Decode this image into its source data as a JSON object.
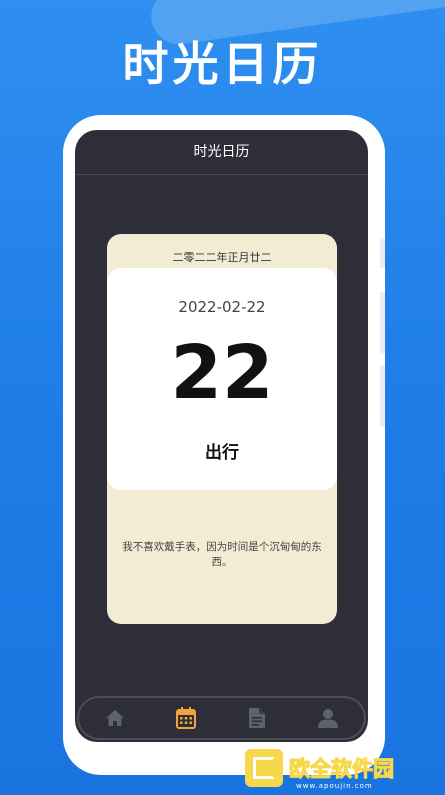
{
  "hero": {
    "title": "时光日历"
  },
  "app": {
    "title": "时光日历"
  },
  "card": {
    "lunar_date": "二零二二年正月廿二",
    "date": "2022-02-22",
    "day": "22",
    "suitable": "出行",
    "quote": "我不喜欢戴手表，因为时间是个沉甸甸的东西。"
  },
  "tabbar": {
    "active_color": "#f0a43c",
    "inactive_color": "#5e6170",
    "items": [
      {
        "icon": "home-icon",
        "active": false
      },
      {
        "icon": "calendar-icon",
        "active": true
      },
      {
        "icon": "document-icon",
        "active": false
      },
      {
        "icon": "user-icon",
        "active": false
      }
    ]
  },
  "watermark": {
    "text": "欧全软件园",
    "sub": "www.apoujin.com"
  },
  "colors": {
    "background": "#1f7ee8",
    "screen": "#2d2e38",
    "card": "#f3ecd5"
  }
}
